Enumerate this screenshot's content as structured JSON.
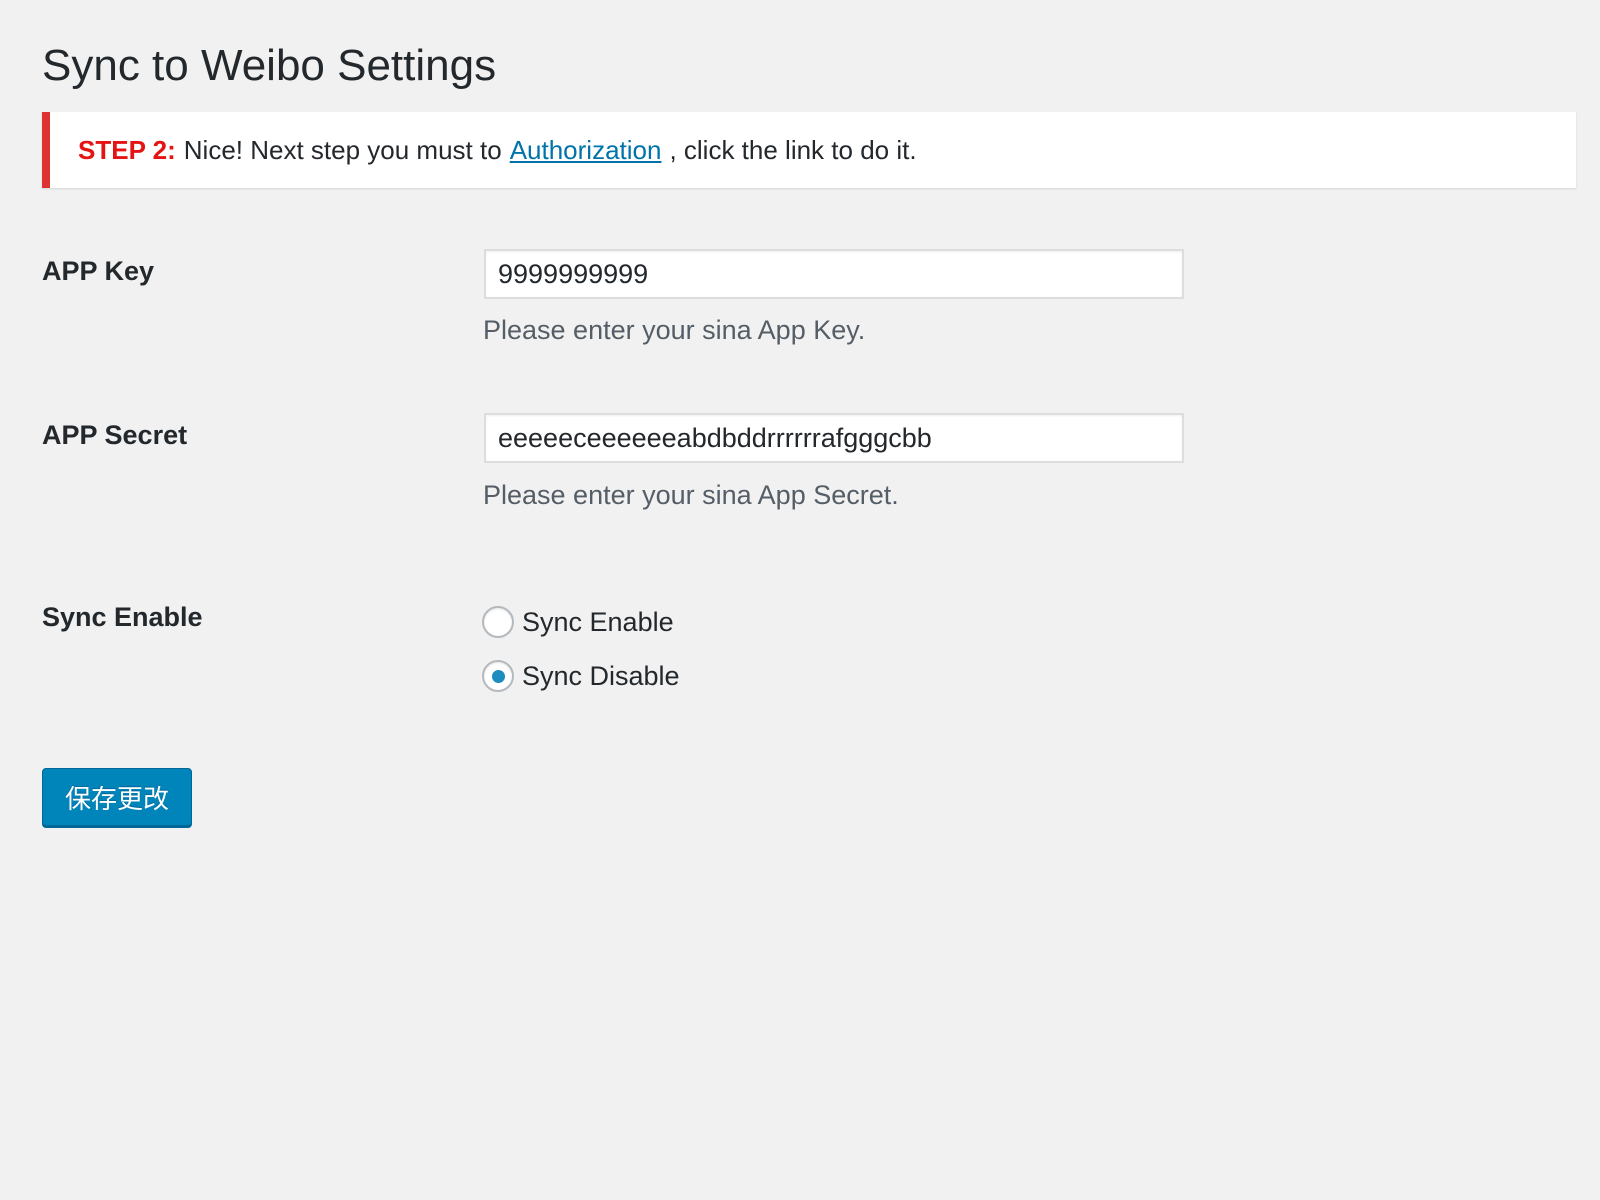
{
  "page": {
    "title": "Sync to Weibo Settings"
  },
  "notice": {
    "step_label": "STEP 2:",
    "text_before": "Nice! Next step you must to",
    "link_text": "Authorization",
    "text_after": ", click the link to do it.",
    "accent_color": "#dc3232",
    "step_color": "#e61313"
  },
  "fields": {
    "app_key": {
      "label": "APP Key",
      "value": "9999999999",
      "description": "Please enter your sina App Key."
    },
    "app_secret": {
      "label": "APP Secret",
      "value": "eeeeeceeeeeeabdbddrrrrrrafgggcbb",
      "description": "Please enter your sina App Secret."
    },
    "sync_enable": {
      "label": "Sync Enable",
      "options": [
        {
          "label": "Sync Enable",
          "checked": false
        },
        {
          "label": "Sync Disable",
          "checked": true
        }
      ]
    }
  },
  "actions": {
    "save_label": "保存更改",
    "button_color": "#0085ba"
  },
  "icons": {
    "radio_unchecked": "radio-unchecked-icon",
    "radio_checked": "radio-checked-icon"
  }
}
